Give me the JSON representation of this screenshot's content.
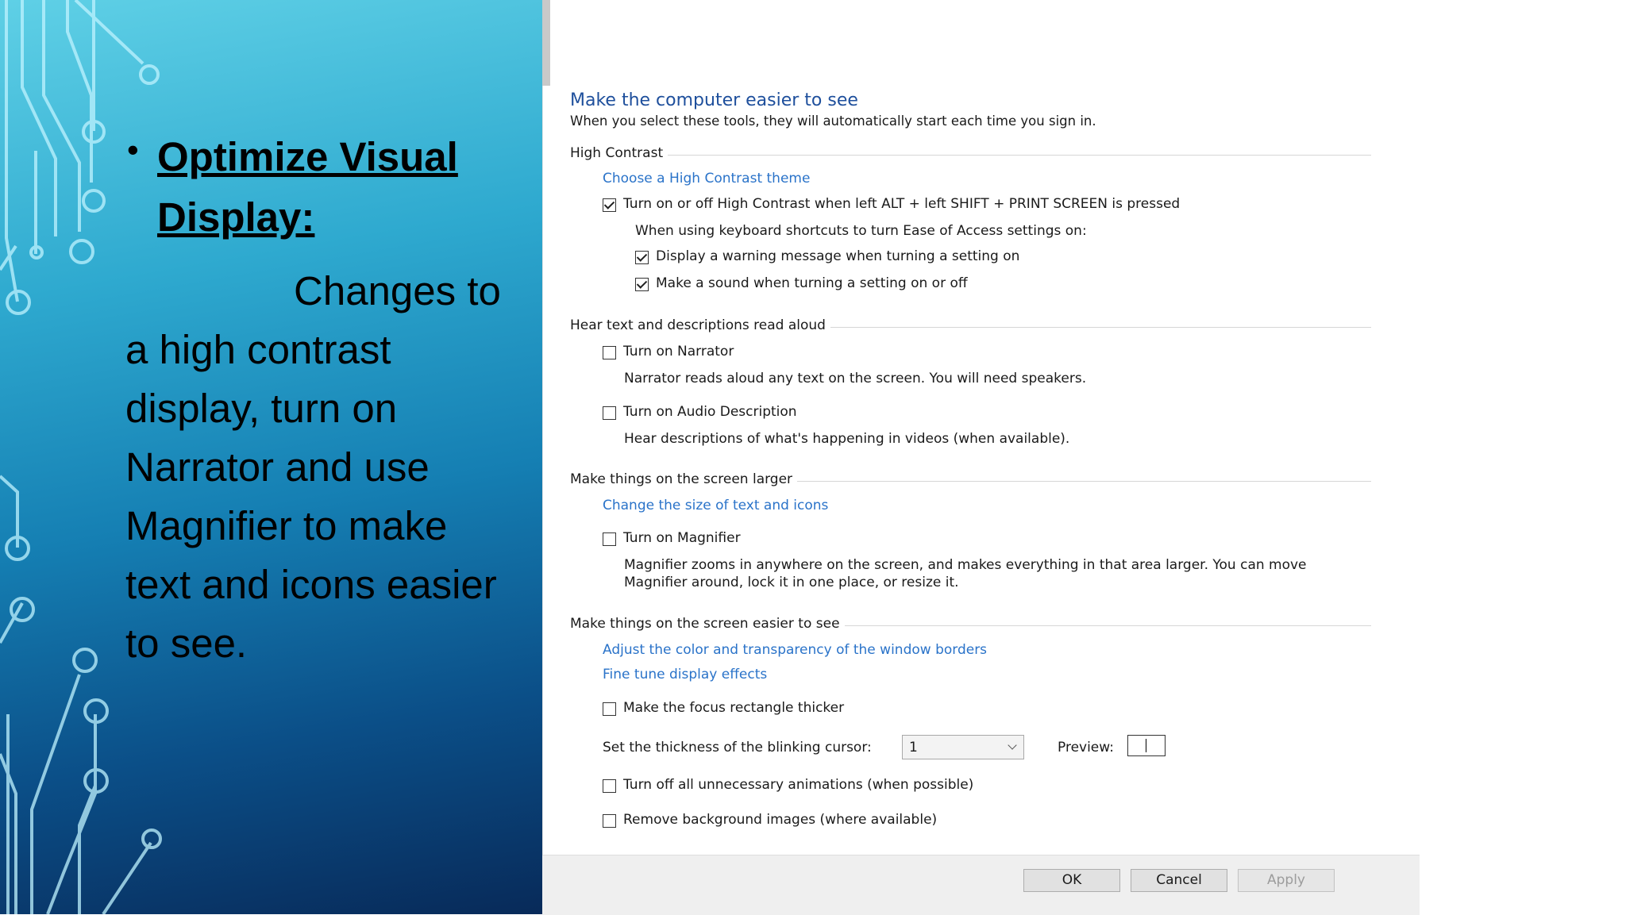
{
  "slide": {
    "heading": "Optimize Visual Display:",
    "body": "Changes to a high contrast display, turn on Narrator and use Magnifier to make text and icons easier to see."
  },
  "dialog": {
    "title": "Make the computer easier to see",
    "subtitle": "When you select these tools, they will automatically start each time you sign in.",
    "high_contrast": {
      "section_label": "High Contrast",
      "theme_link": "Choose a High Contrast theme",
      "toggle_label": "Turn on or off High Contrast when left ALT + left SHIFT + PRINT SCREEN is pressed",
      "toggle_checked": true,
      "shortcut_note": "When using keyboard shortcuts to turn Ease of Access settings on:",
      "warning_label": "Display a warning message when turning a setting on",
      "warning_checked": true,
      "sound_label": "Make a sound when turning a setting on or off",
      "sound_checked": true
    },
    "hear": {
      "section_label": "Hear text and descriptions read aloud",
      "narrator_label": "Turn on Narrator",
      "narrator_checked": false,
      "narrator_desc": "Narrator reads aloud any text on the screen. You will need speakers.",
      "audio_label": "Turn on Audio Description",
      "audio_checked": false,
      "audio_desc": "Hear descriptions of what's happening in videos (when available)."
    },
    "larger": {
      "section_label": "Make things on the screen larger",
      "size_link": "Change the size of text and icons",
      "magnifier_label": "Turn on Magnifier",
      "magnifier_checked": false,
      "magnifier_desc_1": "Magnifier zooms in anywhere on the screen, and makes everything in that area larger. You can move",
      "magnifier_desc_2": "Magnifier around, lock it in one place, or resize it."
    },
    "easier": {
      "section_label": "Make things on the screen easier to see",
      "color_link": "Adjust the color and transparency of the window borders",
      "display_link": "Fine tune display effects",
      "focus_label": "Make the focus rectangle thicker",
      "focus_checked": false,
      "cursor_label": "Set the thickness of the blinking cursor:",
      "cursor_value": "1",
      "preview_label": "Preview:",
      "animations_label": "Turn off all unnecessary animations (when possible)",
      "animations_checked": false,
      "background_label": "Remove background images (where available)",
      "background_checked": false
    },
    "buttons": {
      "ok": "OK",
      "cancel": "Cancel",
      "apply": "Apply"
    }
  },
  "colors": {
    "title": "#1e4f9c",
    "link": "#2a73c9",
    "slide_top": "#5fd0e6",
    "slide_bottom": "#082a59"
  }
}
